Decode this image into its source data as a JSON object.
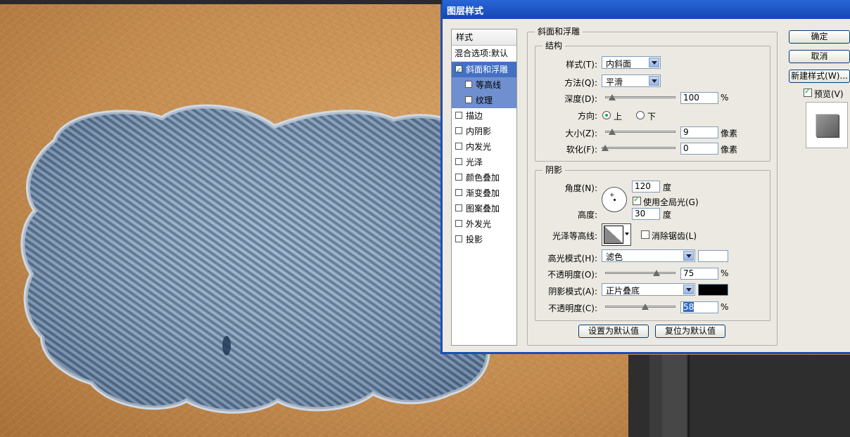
{
  "dialog": {
    "title": "图层样式",
    "buttons": {
      "ok": "确定",
      "cancel": "取消",
      "new_style": "新建样式(W)..."
    },
    "preview": {
      "label": "预览(V)",
      "checked": true
    }
  },
  "style_list": {
    "header": "样式",
    "blend_options": "混合选项:默认",
    "items": [
      {
        "label": "斜面和浮雕",
        "checked": true,
        "selected": true
      },
      {
        "label": "等高线",
        "checked": false,
        "sub": true
      },
      {
        "label": "纹理",
        "checked": false,
        "sub": true
      },
      {
        "label": "描边",
        "checked": false
      },
      {
        "label": "内阴影",
        "checked": false
      },
      {
        "label": "内发光",
        "checked": false
      },
      {
        "label": "光泽",
        "checked": false
      },
      {
        "label": "颜色叠加",
        "checked": false
      },
      {
        "label": "渐变叠加",
        "checked": false
      },
      {
        "label": "图案叠加",
        "checked": false
      },
      {
        "label": "外发光",
        "checked": false
      },
      {
        "label": "投影",
        "checked": false
      }
    ]
  },
  "bevel": {
    "legend": "斜面和浮雕",
    "structure": {
      "legend": "结构",
      "style_label": "样式(T):",
      "style_value": "内斜面",
      "technique_label": "方法(Q):",
      "technique_value": "平滑",
      "depth_label": "深度(D):",
      "depth_value": "100",
      "depth_unit": "%",
      "depth_level": 0.05,
      "direction_label": "方向:",
      "direction_up": "上",
      "direction_down": "下",
      "direction_selected": "up",
      "size_label": "大小(Z):",
      "size_value": "9",
      "size_unit": "像素",
      "size_level": 0.06,
      "soften_label": "软化(F):",
      "soften_value": "0",
      "soften_unit": "像素",
      "soften_level": 0.0
    },
    "shading": {
      "legend": "阴影",
      "angle_label": "角度(N):",
      "angle_value": "120",
      "angle_unit": "度",
      "global_light_label": "使用全局光(G)",
      "global_light_checked": true,
      "altitude_label": "高度:",
      "altitude_value": "30",
      "altitude_unit": "度",
      "gloss_contour_label": "光泽等高线:",
      "anti_alias_label": "消除锯齿(L)",
      "anti_alias_checked": false,
      "highlight_mode_label": "高光模式(H):",
      "highlight_mode_value": "滤色",
      "highlight_color": "#ffffff",
      "highlight_opacity_label": "不透明度(O):",
      "highlight_opacity_value": "75",
      "highlight_opacity_unit": "%",
      "highlight_opacity_level": 0.75,
      "shadow_mode_label": "阴影模式(A):",
      "shadow_mode_value": "正片叠底",
      "shadow_color": "#000000",
      "shadow_opacity_label": "不透明度(C):",
      "shadow_opacity_value": "58",
      "shadow_opacity_unit": "%",
      "shadow_opacity_level": 0.58
    },
    "make_default": "设置为默认值",
    "reset_default": "复位为默认值"
  }
}
